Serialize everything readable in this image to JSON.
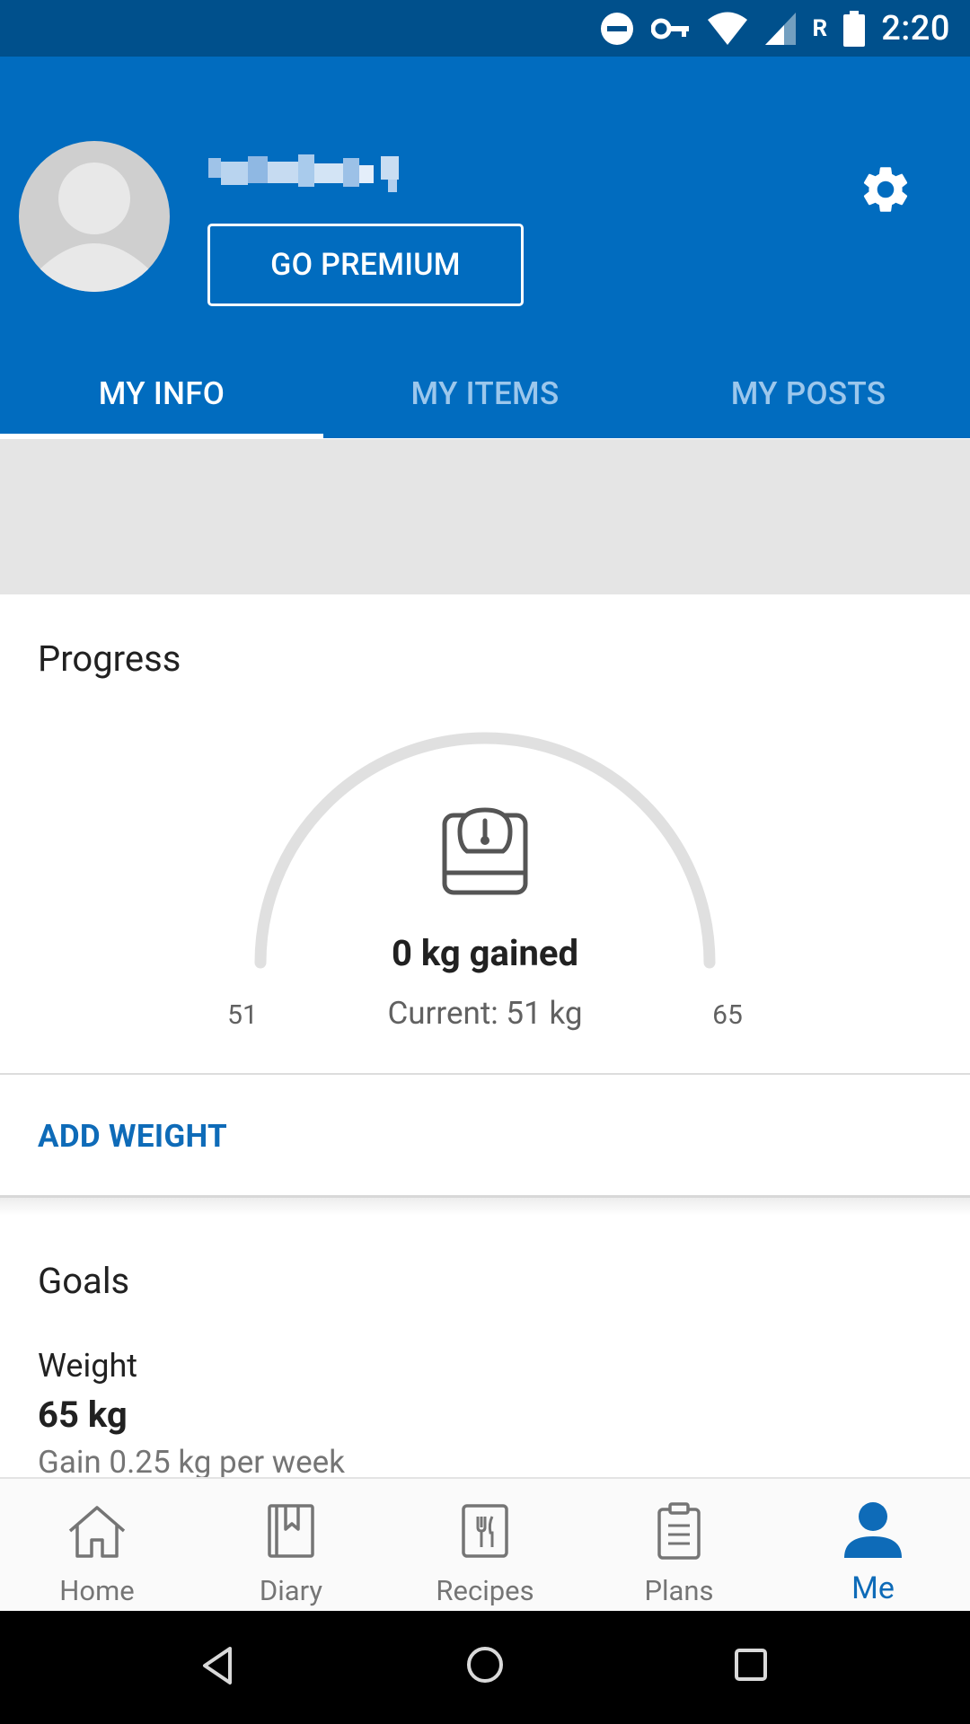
{
  "status_bar": {
    "time": "2:20",
    "carrier_flag": "R",
    "icons": [
      "do-not-disturb-icon",
      "vpn-key-icon",
      "wifi-icon",
      "signal-icon",
      "battery-icon"
    ]
  },
  "header": {
    "premium_label": "GO PREMIUM",
    "tabs": [
      {
        "label": "MY INFO",
        "active": true
      },
      {
        "label": "MY ITEMS",
        "active": false
      },
      {
        "label": "MY POSTS",
        "active": false
      }
    ]
  },
  "progress": {
    "title": "Progress",
    "gained_text": "0 kg gained",
    "current_text": "Current: 51 kg",
    "min_label": "51",
    "max_label": "65",
    "progress_fraction": 0
  },
  "add_weight_label": "ADD WEIGHT",
  "goals": {
    "title": "Goals",
    "weight_label": "Weight",
    "weight_value": "65 kg",
    "weight_sub": "Gain 0.25 kg per week"
  },
  "bottom_nav": [
    {
      "label": "Home",
      "icon": "home-icon"
    },
    {
      "label": "Diary",
      "icon": "diary-icon"
    },
    {
      "label": "Recipes",
      "icon": "recipes-icon"
    },
    {
      "label": "Plans",
      "icon": "plans-icon"
    },
    {
      "label": "Me",
      "icon": "person-icon",
      "active": true
    }
  ],
  "colors": {
    "status_bar": "#00508c",
    "header": "#016cbf",
    "accent": "#0e6bb8",
    "gauge_track": "#e0e0e0"
  }
}
